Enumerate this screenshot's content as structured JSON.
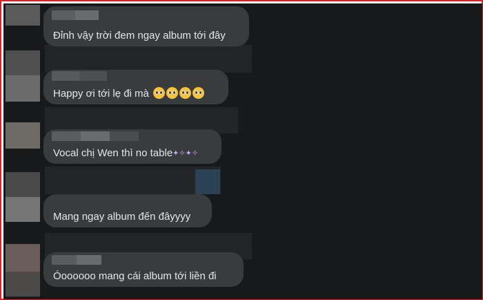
{
  "comments": [
    {
      "text": "Đỉnh vậy trời đem ngay album tới đây"
    },
    {
      "text": "Happy ơi tới lẹ đi mà",
      "emoji": [
        "pleading-face-icon",
        "pleading-face-icon",
        "pleading-face-icon",
        "pleading-face-icon"
      ]
    },
    {
      "text": "Vocal chị Wen thì no table",
      "emoji": [
        "sparkles-icon",
        "sparkles-icon"
      ]
    },
    {
      "text": "Mang ngay album đến đâyyyy"
    },
    {
      "text": "Óoooooo mang cái album tới liền đi"
    }
  ],
  "colors": {
    "frame_border": "#e0202a",
    "background": "#18191a",
    "bubble": "#3a3b3c",
    "text": "#e4e6eb"
  }
}
